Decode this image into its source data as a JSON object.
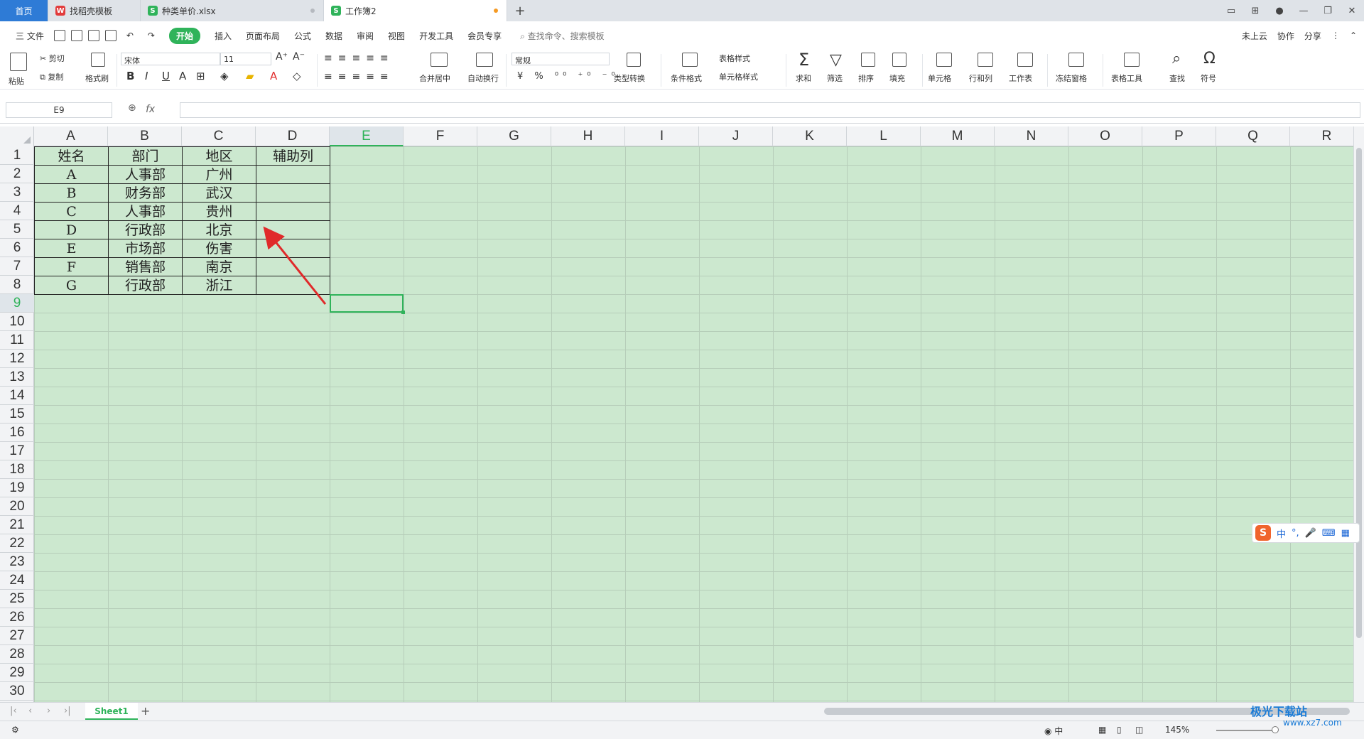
{
  "tabs": [
    {
      "label": "首页"
    },
    {
      "label": "找稻壳模板",
      "icon": "docer-icon"
    },
    {
      "label": "种类单价.xlsx",
      "icon": "spreadsheet-icon"
    },
    {
      "label": "工作簿2",
      "icon": "spreadsheet-icon"
    }
  ],
  "menu": {
    "file": "三 文件",
    "items": [
      "开始",
      "插入",
      "页面布局",
      "公式",
      "数据",
      "审阅",
      "视图",
      "开发工具",
      "会员专享"
    ],
    "search_placeholder": "查找命令、搜索模板",
    "cloud": "未上云",
    "collab": "协作",
    "share": "分享"
  },
  "ribbon": {
    "paste": "粘贴",
    "cut": "剪切",
    "copy": "复制",
    "format_painter": "格式刷",
    "font_name": "宋体",
    "font_size": "11",
    "merge": "合并居中",
    "wrap": "自动换行",
    "number_format": "常规",
    "convert": "类型转换",
    "cond_format": "条件格式",
    "table_style": "表格样式",
    "cell_style": "单元格样式",
    "sum": "求和",
    "filter": "筛选",
    "sort": "排序",
    "fill": "填充",
    "cell": "单元格",
    "rowcol": "行和列",
    "sheet": "工作表",
    "freeze": "冻结窗格",
    "table_tools": "表格工具",
    "find": "查找",
    "symbol": "符号"
  },
  "formula_bar": {
    "name_box": "E9",
    "fx": "fx",
    "value": ""
  },
  "columns": [
    "A",
    "B",
    "C",
    "D",
    "E",
    "F",
    "G",
    "H",
    "I",
    "J",
    "K",
    "L",
    "M",
    "N",
    "O",
    "P",
    "Q",
    "R"
  ],
  "rows": [
    "1",
    "2",
    "3",
    "4",
    "5",
    "6",
    "7",
    "8",
    "9",
    "10",
    "11",
    "12",
    "13",
    "14",
    "15",
    "16",
    "17",
    "18",
    "19",
    "20",
    "21",
    "22",
    "23",
    "24",
    "25",
    "26",
    "27",
    "28",
    "29",
    "30"
  ],
  "table": [
    [
      "姓名",
      "部门",
      "地区",
      "辅助列"
    ],
    [
      "A",
      "人事部",
      "广州",
      ""
    ],
    [
      "B",
      "财务部",
      "武汉",
      ""
    ],
    [
      "C",
      "人事部",
      "贵州",
      ""
    ],
    [
      "D",
      "行政部",
      "北京",
      ""
    ],
    [
      "E",
      "市场部",
      "伤害",
      ""
    ],
    [
      "F",
      "销售部",
      "南京",
      ""
    ],
    [
      "G",
      "行政部",
      "浙江",
      ""
    ]
  ],
  "ime": {
    "logo": "S",
    "lang": "中",
    "punct": "°,"
  },
  "sheets": [
    "Sheet1"
  ],
  "status": {
    "zoom": "145%"
  },
  "watermark": {
    "title": "极光下载站",
    "url": "www.xz7.com"
  },
  "colors": {
    "accent": "#2fb35a",
    "grid_bg": "#cce8cf",
    "home_tab": "#2e7bd6",
    "annotation_arrow": "#e02a2a"
  }
}
